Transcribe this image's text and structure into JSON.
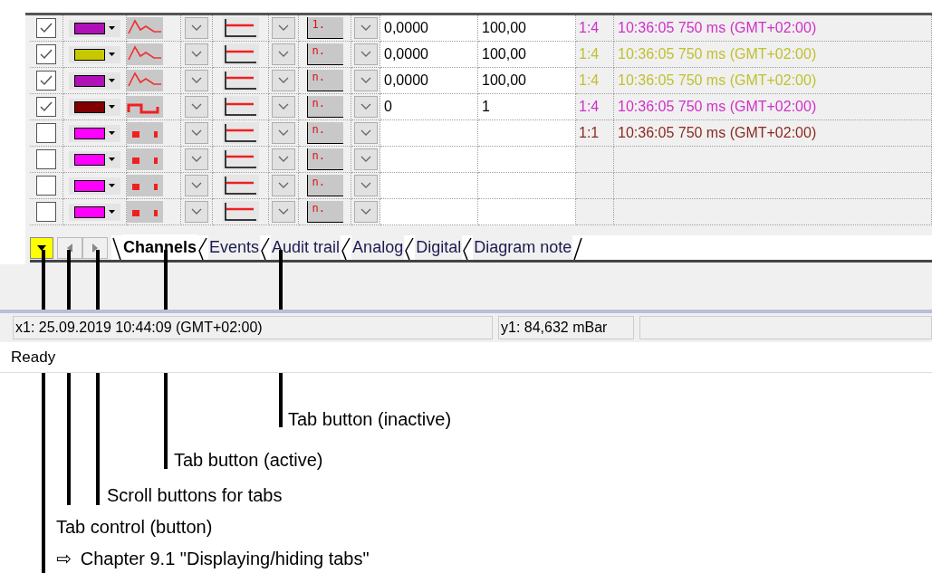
{
  "rows": [
    {
      "checked": true,
      "swatch": {
        "color": "#b010b8"
      },
      "curve": {
        "kind": "analog"
      },
      "axis_label": "1.",
      "min": "0,0000",
      "max": "100,00",
      "ratio": "1:4",
      "timestamp": {
        "text": "10:36:05 750 ms (GMT+02:00)",
        "color": "#d030c8"
      }
    },
    {
      "checked": true,
      "swatch": {
        "color": "#c8c800"
      },
      "curve": {
        "kind": "analog"
      },
      "axis_label": "n.",
      "min": "0,0000",
      "max": "100,00",
      "ratio": "1:4",
      "timestamp": {
        "text": "10:36:05 750 ms (GMT+02:00)",
        "color": "#c0c030"
      }
    },
    {
      "checked": true,
      "swatch": {
        "color": "#b010b8"
      },
      "curve": {
        "kind": "analog"
      },
      "axis_label": "n.",
      "min": "0,0000",
      "max": "100,00",
      "ratio": "1:4",
      "timestamp": {
        "text": "10:36:05 750 ms (GMT+02:00)",
        "color": "#c0c030"
      }
    },
    {
      "checked": true,
      "swatch": {
        "color": "#800000"
      },
      "curve": {
        "kind": "digital"
      },
      "axis_label": "n.",
      "min": "0",
      "max": "1",
      "ratio": "1:4",
      "timestamp": {
        "text": "10:36:05 750 ms (GMT+02:00)",
        "color": "#d030c8"
      }
    },
    {
      "checked": false,
      "swatch": {
        "color": "#ff00ff"
      },
      "curve": {
        "kind": "pulse"
      },
      "axis_label": "n.",
      "ratio": "1:1",
      "timestamp": {
        "text": "10:36:05 750 ms (GMT+02:00)",
        "color": "#8b2a20"
      }
    },
    {
      "checked": false,
      "swatch": {
        "color": "#ff00ff"
      },
      "curve": {
        "kind": "pulse"
      },
      "axis_label": "n."
    },
    {
      "checked": false,
      "swatch": {
        "color": "#ff00ff"
      },
      "curve": {
        "kind": "pulse"
      },
      "axis_label": "n."
    },
    {
      "checked": false,
      "swatch": {
        "color": "#ff00ff"
      },
      "curve": {
        "kind": "pulse"
      },
      "axis_label": "n."
    }
  ],
  "tabs": [
    {
      "label": "Channels",
      "selected": true
    },
    {
      "label": "Events",
      "selected": false
    },
    {
      "label": "Audit trail",
      "selected": false
    },
    {
      "label": "Analog",
      "selected": false
    },
    {
      "label": "Digital",
      "selected": false
    },
    {
      "label": "Diagram note",
      "selected": false
    }
  ],
  "status_bar": {
    "cursor_x": "x1: 25.09.2019 10:44:09 (GMT+02:00)",
    "cursor_y": "y1: 84,632 mBar",
    "message": "Ready"
  },
  "callouts": [
    {
      "text": "Tab button (inactive)"
    },
    {
      "text": "Tab button (active)"
    },
    {
      "text": "Scroll buttons for tabs"
    },
    {
      "text": "Tab control (button)"
    },
    {
      "arrow": "⇨",
      "text": "Chapter 9.1 \"Displaying/hiding tabs\""
    }
  ]
}
